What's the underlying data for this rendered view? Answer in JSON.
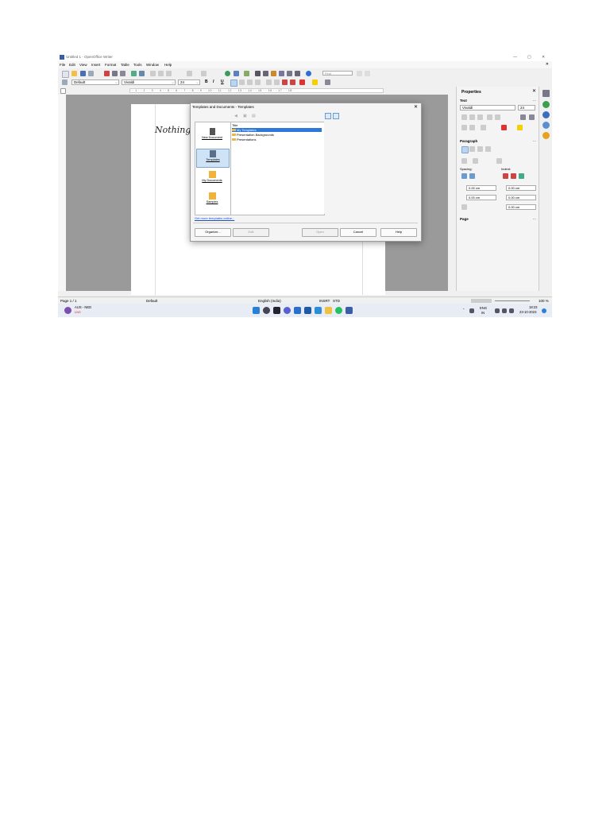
{
  "window": {
    "title": "Untitled 1 - OpenOffice Writer",
    "minimize": "—",
    "maximize": "▢",
    "close": "✕"
  },
  "menubar": {
    "items": [
      "File",
      "Edit",
      "View",
      "Insert",
      "Format",
      "Table",
      "Tools",
      "Window",
      "Help"
    ],
    "close_doc": "✕"
  },
  "toolbar": {
    "find_placeholder": "Find"
  },
  "format_toolbar": {
    "style": "Default",
    "font": "Vivaldi",
    "size": "24",
    "bold": "B",
    "italic": "I",
    "underline": "U"
  },
  "ruler": {
    "ticks": "· · 1 · · 2 · · 3 · · 4 · · 5 · · 6 · · 7 · · 8 · · 9 · · 10 · · 11 · · 12 · · 13 · · 14 · · 15 · · 16 · · 17 · · 18 ·"
  },
  "document": {
    "text": "Nothing's"
  },
  "dialog": {
    "title": "Templates and Documents - Templates",
    "close": "✕",
    "left_pane": [
      {
        "label": "New Document",
        "icon": "new-document-icon"
      },
      {
        "label": "Templates",
        "icon": "templates-icon"
      },
      {
        "label": "My Documents",
        "icon": "my-documents-icon"
      },
      {
        "label": "Samples",
        "icon": "samples-icon"
      }
    ],
    "tree_header": "Title",
    "tree_items": [
      "My Templates",
      "Presentation Backgrounds",
      "Presentations"
    ],
    "link": "Get more templates online...",
    "buttons": {
      "organize": "Organize...",
      "edit": "Edit",
      "open": "Open",
      "cancel": "Cancel",
      "help": "Help"
    }
  },
  "sidebar": {
    "title": "Properties",
    "close": "✕",
    "text_section": "Text",
    "font": "Vivaldi",
    "size": "24",
    "paragraph_section": "Paragraph",
    "spacing_label": "Spacing:",
    "indent_label": "Indent:",
    "spin_values": [
      "0.00 cm",
      "0.00 cm",
      "0.00 cm",
      "0.00 cm",
      "0.00 cm"
    ],
    "page_section": "Page"
  },
  "statusbar": {
    "page": "Page 1 / 1",
    "style": "Default",
    "language": "English (India)",
    "mode": "INSRT",
    "sel": "STD",
    "zoom": "100 %"
  },
  "taskbar": {
    "weather_title": "AUS - NED",
    "weather_sub": "Live",
    "lang_top": "ENG",
    "lang_bottom": "IN",
    "time": "18:23",
    "date": "23-10-2023"
  },
  "colors": {
    "accent": "#2f78d8",
    "folder": "#e8b84a",
    "doc_bg": "#9a9a9a"
  }
}
